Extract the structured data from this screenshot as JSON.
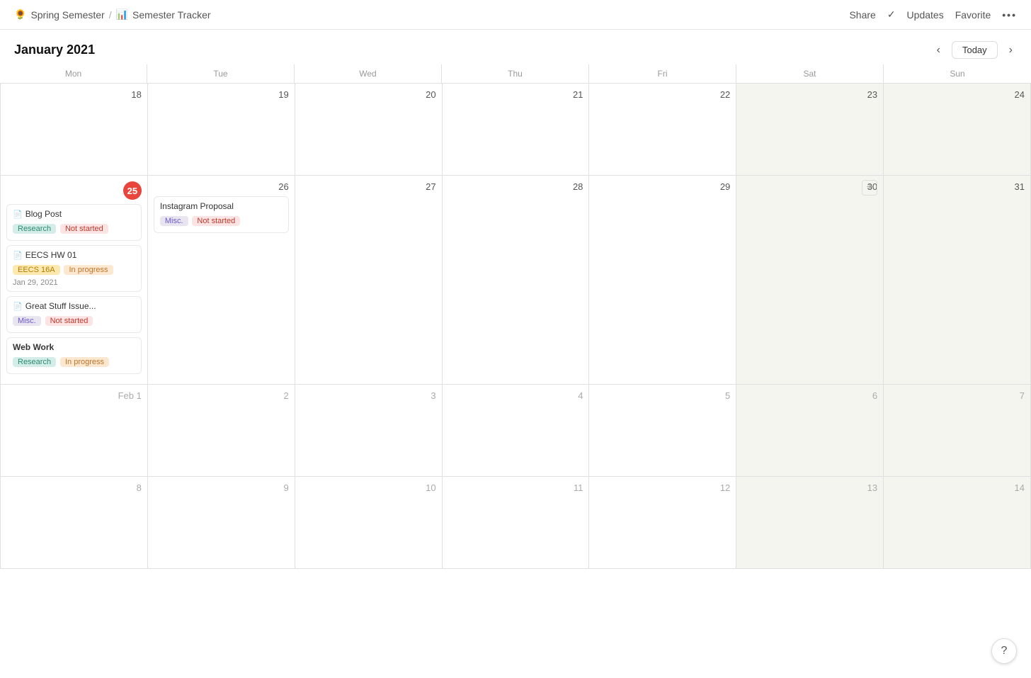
{
  "breadcrumb": {
    "part1": "Spring Semester",
    "sep": "/",
    "part2": "Semester Tracker",
    "emoji1": "🌻",
    "emoji2": "📊"
  },
  "nav": {
    "share": "Share",
    "updates": "Updates",
    "favorite": "Favorite",
    "check": "✓",
    "dots": "•••"
  },
  "calendar": {
    "title": "January 2021",
    "today_btn": "Today",
    "nav_prev": "‹",
    "nav_next": "›",
    "day_labels": [
      "Mon",
      "Tue",
      "Wed",
      "Thu",
      "Fri",
      "Sat",
      "Sun"
    ]
  },
  "weeks": [
    {
      "days": [
        {
          "num": "18",
          "weekend": false,
          "other_month": false,
          "events": []
        },
        {
          "num": "19",
          "weekend": false,
          "other_month": false,
          "events": []
        },
        {
          "num": "20",
          "weekend": false,
          "other_month": false,
          "events": []
        },
        {
          "num": "21",
          "weekend": false,
          "other_month": false,
          "events": []
        },
        {
          "num": "22",
          "weekend": false,
          "other_month": false,
          "events": []
        },
        {
          "num": "23",
          "weekend": true,
          "other_month": false,
          "events": []
        },
        {
          "num": "24",
          "weekend": true,
          "other_month": false,
          "events": []
        }
      ]
    },
    {
      "days": [
        {
          "num": "25",
          "today": true,
          "weekend": false,
          "other_month": false,
          "events": [
            {
              "title": "Blog Post",
              "icon": true,
              "tags": [
                "Research",
                "Not started"
              ],
              "tag_classes": [
                "tag-research",
                "tag-not-started"
              ]
            },
            {
              "title": "EECS HW 01",
              "icon": true,
              "tags": [
                "EECS 16A",
                "In progress"
              ],
              "tag_classes": [
                "tag-eecs",
                "tag-in-progress"
              ],
              "date": "Jan 29, 2021"
            },
            {
              "title": "Great Stuff Issue...",
              "icon": true,
              "tags": [
                "Misc.",
                "Not started"
              ],
              "tag_classes": [
                "tag-misc",
                "tag-not-started"
              ]
            },
            {
              "title": "Web Work",
              "icon": false,
              "tags": [
                "Research",
                "In progress"
              ],
              "tag_classes": [
                "tag-research",
                "tag-in-progress"
              ]
            }
          ]
        },
        {
          "num": "26",
          "weekend": false,
          "other_month": false,
          "events": [
            {
              "title": "Instagram Proposal",
              "icon": false,
              "tags": [
                "Misc.",
                "Not started"
              ],
              "tag_classes": [
                "tag-misc",
                "tag-not-started"
              ]
            }
          ]
        },
        {
          "num": "27",
          "weekend": false,
          "other_month": false,
          "events": []
        },
        {
          "num": "28",
          "weekend": false,
          "other_month": false,
          "events": []
        },
        {
          "num": "29",
          "weekend": false,
          "other_month": false,
          "events": []
        },
        {
          "num": "30",
          "weekend": true,
          "other_month": false,
          "add_btn": true,
          "events": []
        },
        {
          "num": "31",
          "weekend": true,
          "other_month": false,
          "events": []
        }
      ]
    },
    {
      "days": [
        {
          "num": "Feb 1",
          "weekend": false,
          "other_month": true,
          "events": []
        },
        {
          "num": "2",
          "weekend": false,
          "other_month": true,
          "events": []
        },
        {
          "num": "3",
          "weekend": false,
          "other_month": true,
          "events": []
        },
        {
          "num": "4",
          "weekend": false,
          "other_month": true,
          "events": []
        },
        {
          "num": "5",
          "weekend": false,
          "other_month": true,
          "events": []
        },
        {
          "num": "6",
          "weekend": true,
          "other_month": true,
          "events": []
        },
        {
          "num": "7",
          "weekend": true,
          "other_month": true,
          "events": []
        }
      ]
    },
    {
      "days": [
        {
          "num": "8",
          "weekend": false,
          "other_month": true,
          "events": []
        },
        {
          "num": "9",
          "weekend": false,
          "other_month": true,
          "events": []
        },
        {
          "num": "10",
          "weekend": false,
          "other_month": true,
          "events": []
        },
        {
          "num": "11",
          "weekend": false,
          "other_month": true,
          "events": []
        },
        {
          "num": "12",
          "weekend": false,
          "other_month": true,
          "events": []
        },
        {
          "num": "13",
          "weekend": true,
          "other_month": true,
          "events": []
        },
        {
          "num": "14",
          "weekend": true,
          "other_month": true,
          "events": []
        }
      ]
    }
  ],
  "help": "?"
}
